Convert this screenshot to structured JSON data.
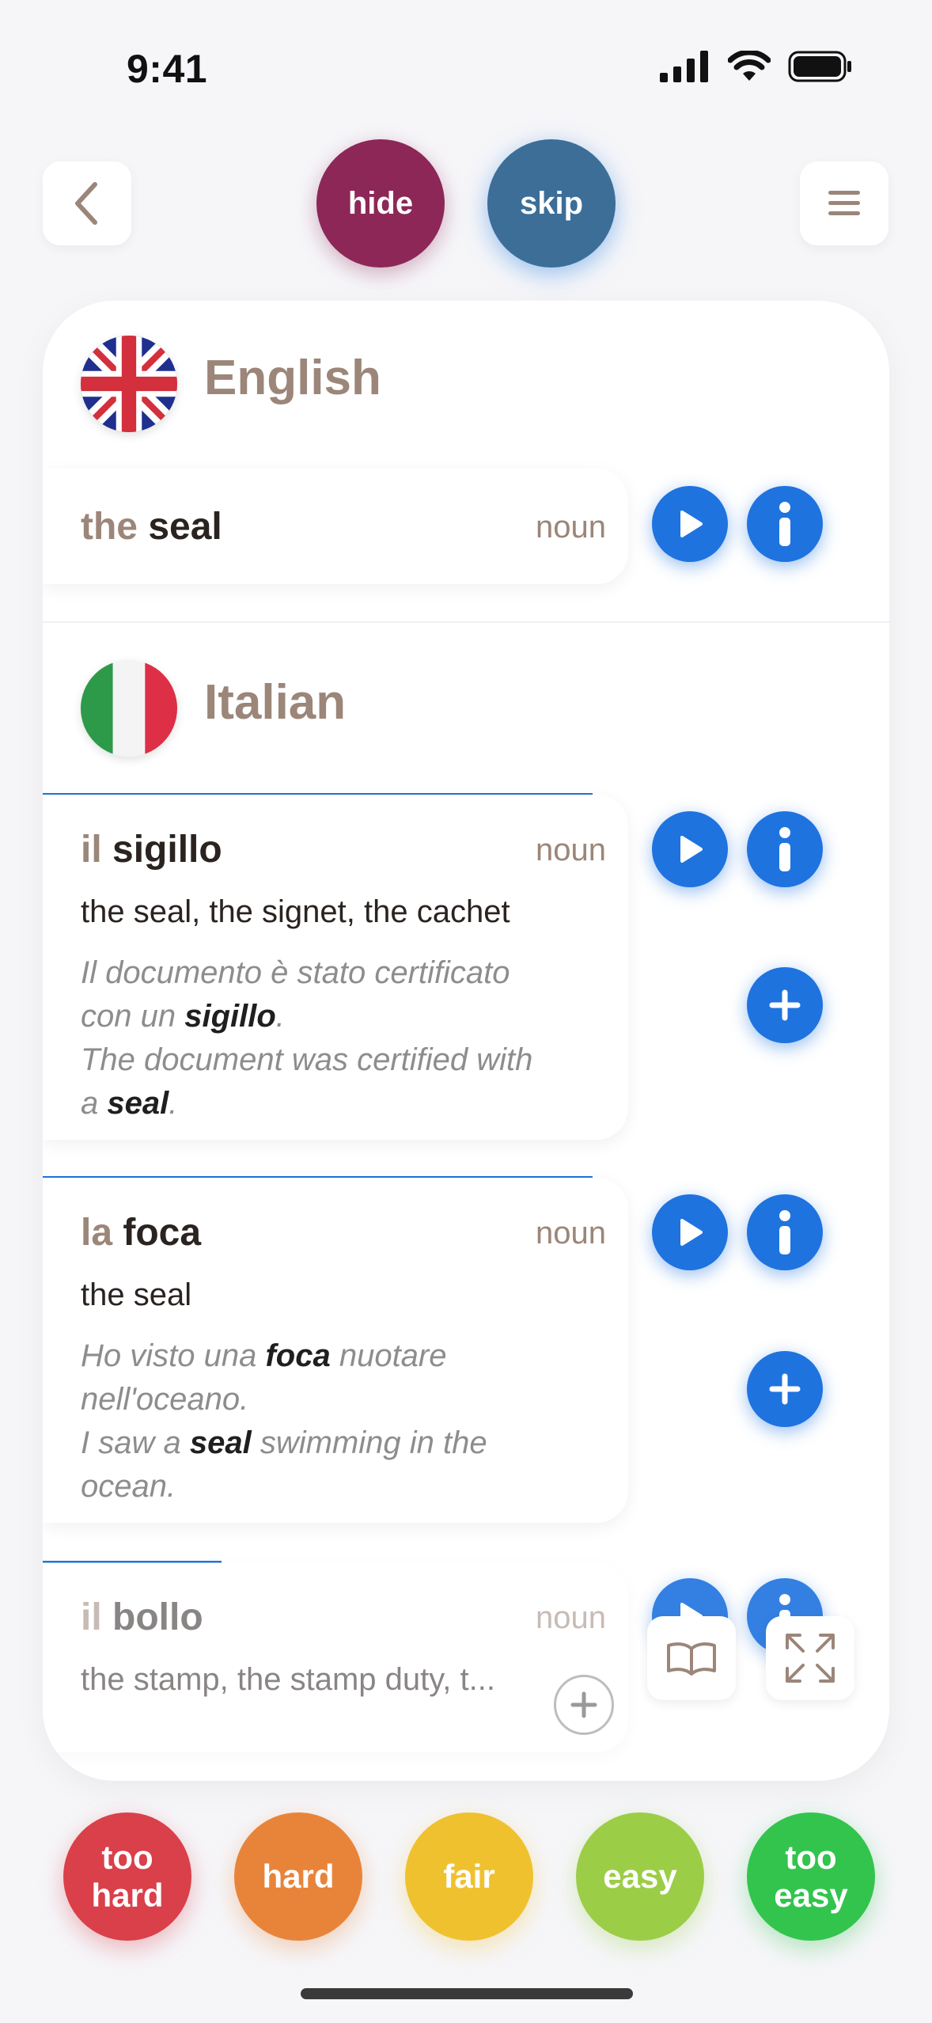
{
  "status_bar": {
    "time": "9:41"
  },
  "nav": {
    "hide_label": "hide",
    "skip_label": "skip"
  },
  "source": {
    "language": "English",
    "entry": {
      "article": "the",
      "word": "seal",
      "pos": "noun"
    }
  },
  "target": {
    "language": "Italian",
    "entries": [
      {
        "article": "il",
        "word": "sigillo",
        "pos": "noun",
        "translation": "the seal, the signet, the cachet",
        "ex_it_1": "Il documento è stato certificato",
        "ex_it_2a": "con un ",
        "ex_it_bold": "sigillo",
        "ex_it_2b": ".",
        "ex_en_1": "The document was certified with",
        "ex_en_2a": "a ",
        "ex_en_bold": "seal",
        "ex_en_2b": "."
      },
      {
        "article": "la",
        "word": "foca",
        "pos": "noun",
        "translation": "the seal",
        "ex_it_1a": "Ho visto una ",
        "ex_it_bold": "foca",
        "ex_it_1b": " nuotare",
        "ex_it_2": "nell'oceano.",
        "ex_en_1a": "I saw a ",
        "ex_en_bold": "seal",
        "ex_en_1b": " swimming in the",
        "ex_en_2": "ocean."
      },
      {
        "article": "il",
        "word": "bollo",
        "pos": "noun",
        "translation": "the stamp, the stamp duty, t..."
      }
    ]
  },
  "ratings": {
    "too_hard_1": "too",
    "too_hard_2": "hard",
    "hard": "hard",
    "fair": "fair",
    "easy": "easy",
    "too_easy_1": "too",
    "too_easy_2": "easy"
  },
  "colors": {
    "hide": "#8c2757",
    "skip": "#3c6e98",
    "accent_blue": "#1e73df",
    "too_hard": "#d9404a",
    "hard": "#e8843a",
    "fair": "#f0c12f",
    "easy": "#9ccd47",
    "too_easy": "#33c44e"
  }
}
